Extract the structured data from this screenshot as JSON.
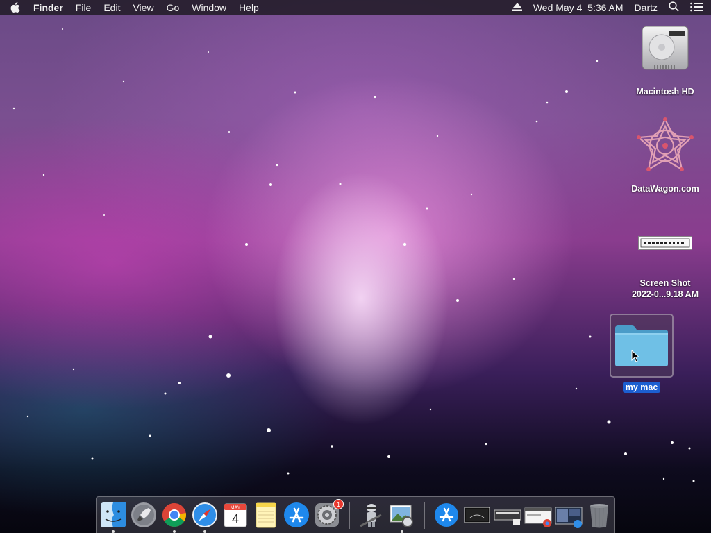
{
  "menubar": {
    "app_name": "Finder",
    "menus": [
      "File",
      "Edit",
      "View",
      "Go",
      "Window",
      "Help"
    ],
    "datetime": "Wed May 4  5:36 AM",
    "user": "Dartz"
  },
  "desktop": {
    "icons": [
      {
        "label": "Macintosh HD",
        "icon": "hard-drive-icon"
      },
      {
        "label": "DataWagon.com",
        "icon": "network-volume-icon"
      },
      {
        "label": "Screen Shot\n2022-0...9.18 AM",
        "label_line1": "Screen Shot",
        "label_line2": "2022-0...9.18 AM",
        "icon": "screenshot-thumbnail"
      },
      {
        "label": "my mac",
        "icon": "folder-icon",
        "selected": true
      }
    ]
  },
  "dock": {
    "apps": [
      {
        "name": "Finder",
        "icon": "finder-icon",
        "running": true
      },
      {
        "name": "Launchpad",
        "icon": "launchpad-icon",
        "running": false
      },
      {
        "name": "Google Chrome",
        "icon": "chrome-icon",
        "running": true
      },
      {
        "name": "Safari",
        "icon": "safari-icon",
        "running": true
      },
      {
        "name": "Calendar",
        "icon": "calendar-icon",
        "running": false,
        "month": "MAY",
        "day": "4"
      },
      {
        "name": "Notes",
        "icon": "notes-icon",
        "running": false
      },
      {
        "name": "App Store",
        "icon": "app-store-icon",
        "running": false
      },
      {
        "name": "System Preferences",
        "icon": "system-preferences-icon",
        "running": false,
        "badge": "1"
      },
      {
        "name": "Automator",
        "icon": "automator-icon",
        "running": false
      },
      {
        "name": "Preview",
        "icon": "preview-icon",
        "running": true
      },
      {
        "name": "App Store Downloads",
        "icon": "downloads-stack-icon"
      },
      {
        "name": "Screenshot 1",
        "icon": "screenshot-thumb-icon"
      },
      {
        "name": "Screenshot 2",
        "icon": "screenshot-thumb-icon"
      },
      {
        "name": "Screenshot 3",
        "icon": "screenshot-thumb-icon"
      },
      {
        "name": "Screenshot 4",
        "icon": "screenshot-thumb-icon"
      },
      {
        "name": "Trash",
        "icon": "trash-icon"
      }
    ]
  },
  "colors": {
    "menubar_bg": "#261e2c",
    "selection_blue": "#1c5fd1",
    "folder_blue": "#6fc0e6",
    "badge_red": "#e8372d"
  }
}
